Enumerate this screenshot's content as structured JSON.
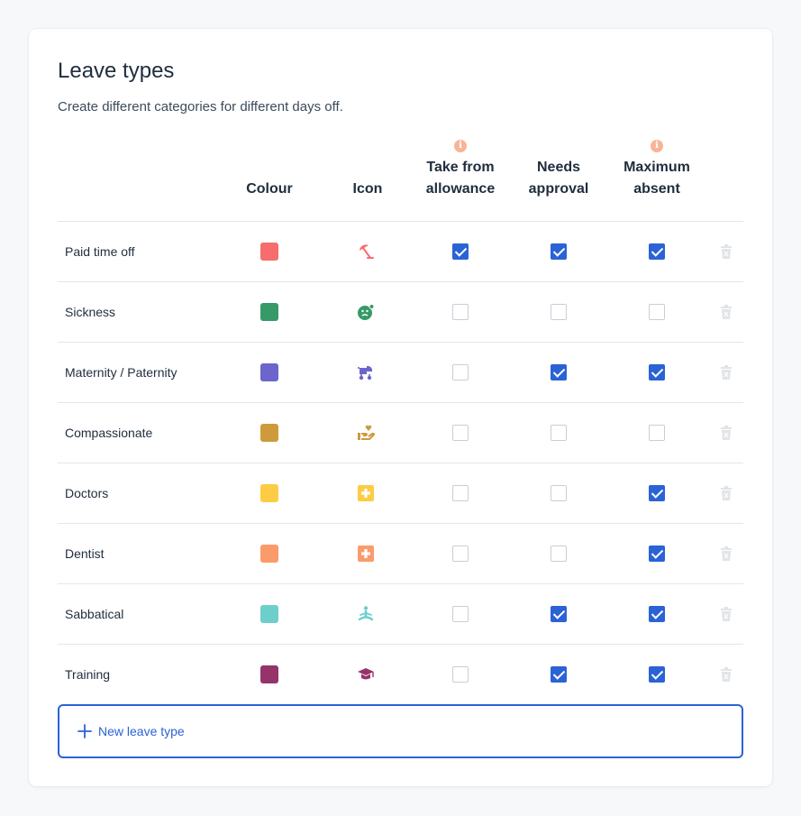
{
  "title": "Leave types",
  "subtitle": "Create different categories for different days off.",
  "columns": {
    "colour": "Colour",
    "icon": "Icon",
    "allowance": [
      "Take from",
      "allowance"
    ],
    "approval": [
      "Needs",
      "approval"
    ],
    "absent": [
      "Maximum",
      "absent"
    ],
    "info_glyph": "i"
  },
  "accent": "#2a63d6",
  "rows": [
    {
      "label": "Paid time off",
      "color": "#f76c6c",
      "icon": "beach-umbrella-icon",
      "allowance": true,
      "approval": true,
      "absent": true
    },
    {
      "label": "Sickness",
      "color": "#369a68",
      "icon": "sick-face-icon",
      "allowance": false,
      "approval": false,
      "absent": false
    },
    {
      "label": "Maternity / Paternity",
      "color": "#6b65cc",
      "icon": "baby-stroller-icon",
      "allowance": false,
      "approval": true,
      "absent": true
    },
    {
      "label": "Compassionate",
      "color": "#cf9a3c",
      "icon": "hand-heart-icon",
      "allowance": false,
      "approval": false,
      "absent": false
    },
    {
      "label": "Doctors",
      "color": "#fdcc44",
      "icon": "medical-cross-icon",
      "allowance": false,
      "approval": false,
      "absent": true
    },
    {
      "label": "Dentist",
      "color": "#fb9b6c",
      "icon": "medical-cross-icon",
      "allowance": false,
      "approval": false,
      "absent": true
    },
    {
      "label": "Sabbatical",
      "color": "#6ccfcc",
      "icon": "meditation-icon",
      "allowance": false,
      "approval": true,
      "absent": true
    },
    {
      "label": "Training",
      "color": "#95336b",
      "icon": "graduation-cap-icon",
      "allowance": false,
      "approval": true,
      "absent": true
    }
  ],
  "new_button": {
    "label": "New leave type",
    "icon": "plus-icon"
  }
}
